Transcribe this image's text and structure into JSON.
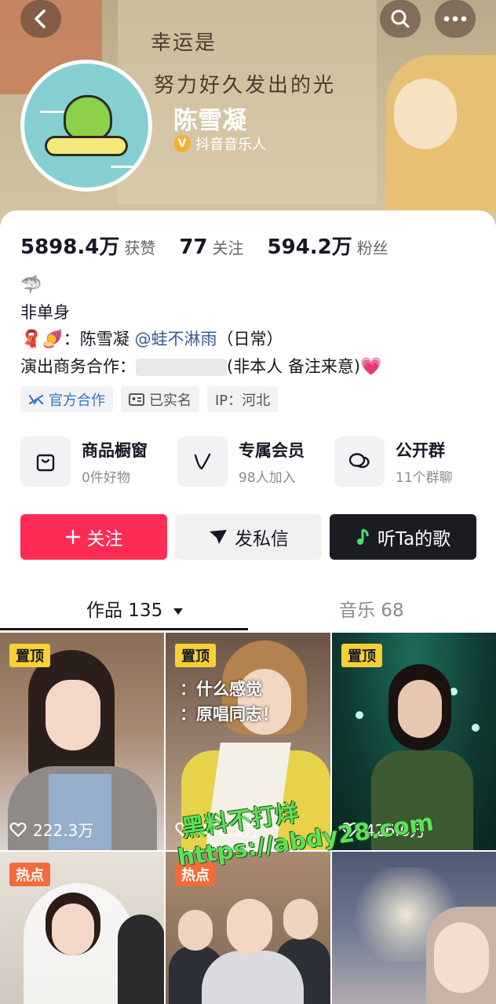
{
  "header": {
    "banner_lines": [
      "幸运是",
      "努力好久发出的光"
    ],
    "name": "陈雪凝",
    "verified_label": "抖音音乐人",
    "verified_glyph": "V"
  },
  "stats": [
    {
      "num": "5898.4万",
      "label": "获赞"
    },
    {
      "num": "77",
      "label": "关注"
    },
    {
      "num": "594.2万",
      "label": "粉丝"
    }
  ],
  "bio": {
    "line0_emoji": "🦈",
    "line1": "非单身",
    "line2_emoji": "🧣🍠",
    "line2_prefix": "：陈雪凝 ",
    "line2_mention": "@蛙不淋雨",
    "line2_suffix": "（日常）",
    "line3_prefix": "演出商务合作：",
    "line3_suffix": "(非本人 备注来意)",
    "line3_emoji": "💗"
  },
  "tags": [
    {
      "label": "官方合作",
      "icon": "handshake-icon"
    },
    {
      "label": "已实名",
      "icon": "id-card-icon"
    },
    {
      "label": "IP：河北",
      "icon": ""
    }
  ],
  "features": [
    {
      "title": "商品橱窗",
      "sub": "0件好物",
      "icon": "shopping-bag-icon"
    },
    {
      "title": "专属会员",
      "sub": "98人加入",
      "icon": "v-member-icon"
    },
    {
      "title": "公开群",
      "sub": "11个群聊",
      "icon": "chat-bubbles-icon"
    }
  ],
  "actions": {
    "follow": "关注",
    "message": "发私信",
    "listen": "听Ta的歌"
  },
  "tabs": {
    "works": "作品 135",
    "music": "音乐 68"
  },
  "videos": [
    {
      "badge": "置顶",
      "badge_type": "pin",
      "likes": "222.3万"
    },
    {
      "badge": "置顶",
      "badge_type": "pin",
      "likes": "478.1万",
      "subtitles": [
        "：什么感觉",
        "：原唱同志！"
      ]
    },
    {
      "badge": "置顶",
      "badge_type": "pin",
      "likes": "426.6万"
    },
    {
      "badge": "热点",
      "badge_type": "hot",
      "likes": ""
    },
    {
      "badge": "热点",
      "badge_type": "hot",
      "likes": ""
    },
    {
      "badge": "",
      "badge_type": "",
      "likes": ""
    }
  ],
  "watermark": {
    "line1": "黑料不打烊",
    "line2": "https://abdy28.com"
  },
  "colors": {
    "follow_red": "#fe2c55",
    "pin_yellow": "#f8d033",
    "hot_orange": "#f26b3a",
    "mention_blue": "#3a5c93"
  }
}
